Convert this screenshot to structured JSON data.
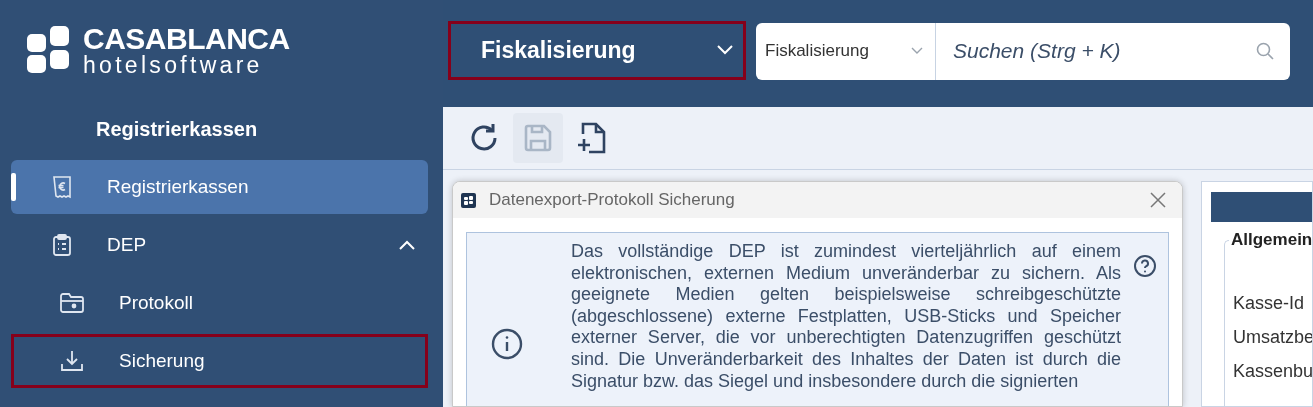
{
  "logo": {
    "name": "CASABLANCA",
    "tagline": "hotelsoftware"
  },
  "sidebar": {
    "title": "Registrierkassen",
    "items": [
      {
        "label": "Registrierkassen",
        "selected": true,
        "highlighted": false
      },
      {
        "label": "DEP",
        "selected": false,
        "highlighted": false,
        "expanded": true,
        "children": [
          {
            "label": "Protokoll",
            "selected": false,
            "highlighted": false
          },
          {
            "label": "Sicherung",
            "selected": false,
            "highlighted": true
          }
        ]
      }
    ]
  },
  "module_select": {
    "value": "Fiskalisierung",
    "highlighted": true
  },
  "search": {
    "scope": "Fiskalisierung",
    "placeholder": "Suchen (Strg + K)"
  },
  "toolbar": [
    {
      "kind": "refresh",
      "disabled": false
    },
    {
      "kind": "save",
      "disabled": true
    },
    {
      "kind": "new",
      "disabled": false
    }
  ],
  "dialog": {
    "title": "Datenexport-Protokoll Sicherung",
    "text": "Das vollständige DEP ist zumindest vierteljährlich auf einem elektronischen, externen Medium unveränderbar zu sichern. Als geeignete Medien gelten beispielsweise schreibgeschützte (abgeschlossene) externe Festplatten, USB-Sticks und Speicher externer Server, die vor unberechtigten Datenzugriffen geschützt sind. Die Unveränderbarkeit des Inhaltes der Daten ist durch die Signatur bzw. das Siegel und insbesondere durch die signierten"
  },
  "detail_panel": {
    "section": "Allgemein",
    "fields": [
      "Kasse-Id",
      "Umsatzbe",
      "Kassenbu"
    ]
  }
}
